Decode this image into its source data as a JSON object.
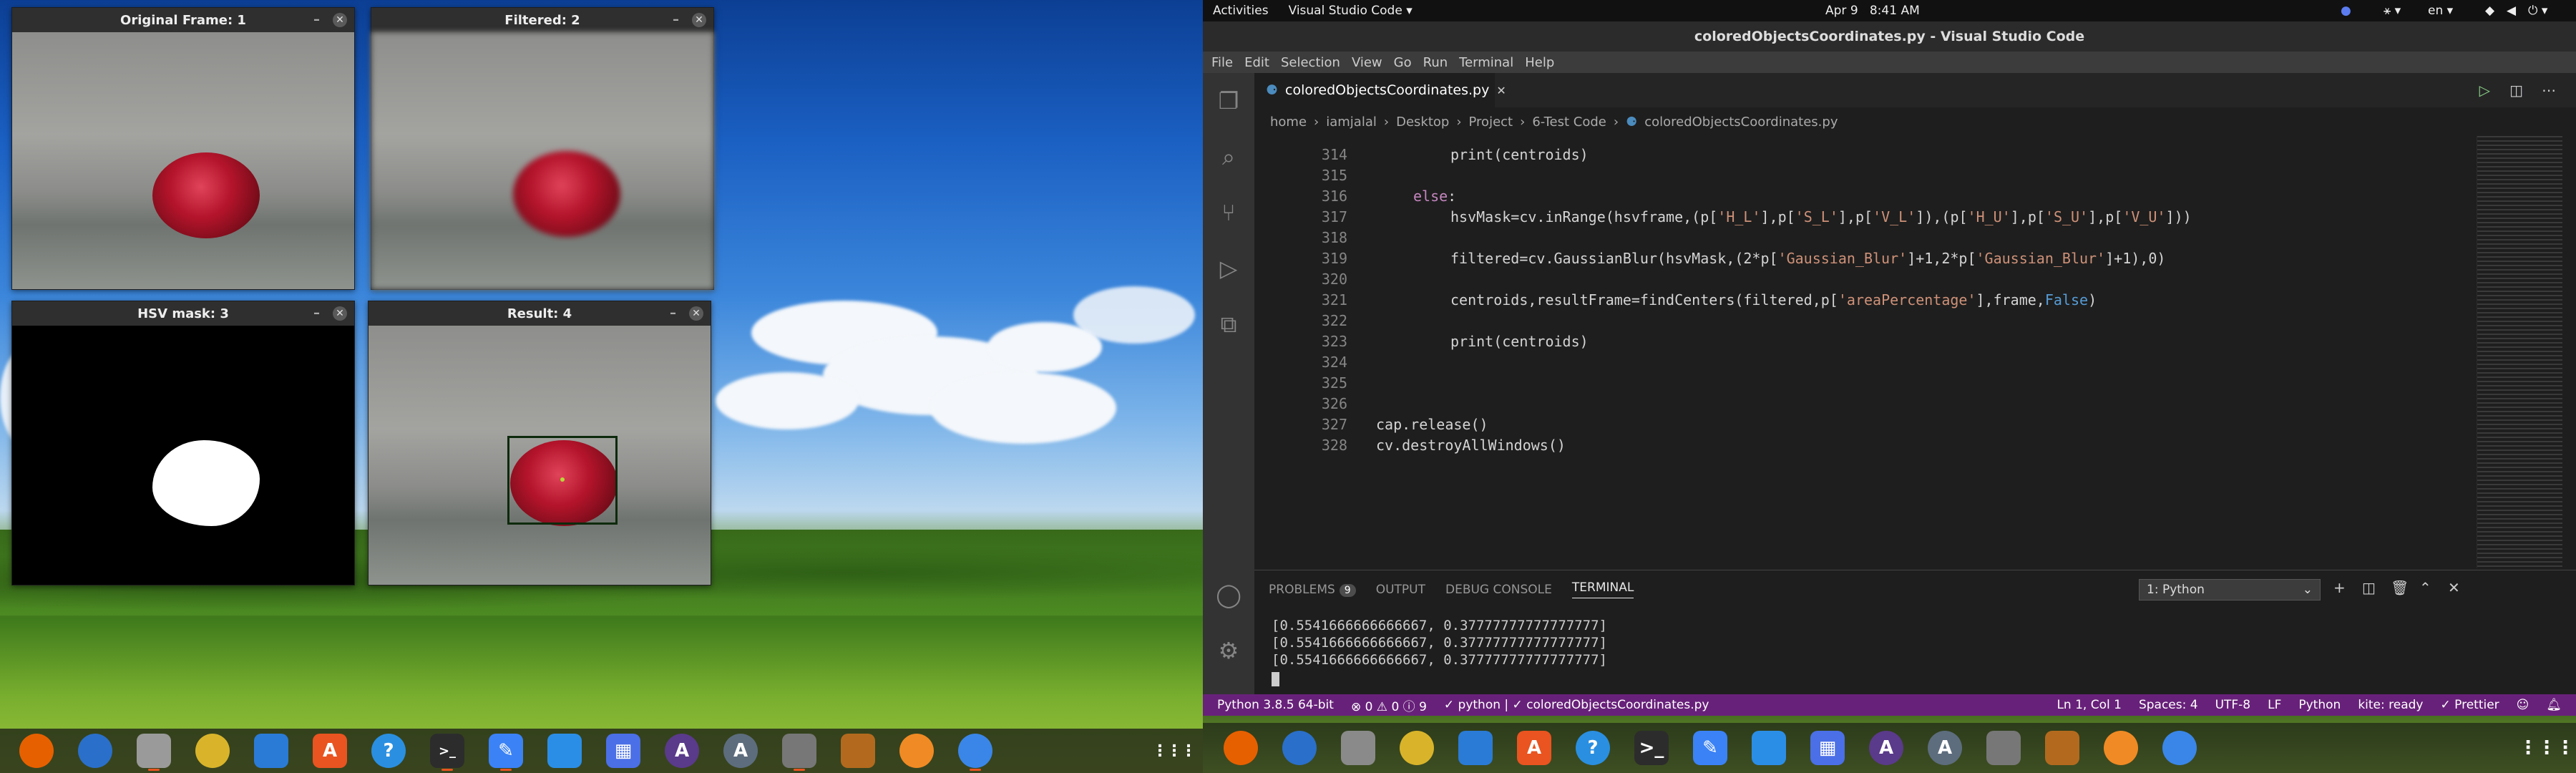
{
  "left_monitor": {
    "windows": [
      {
        "title": "Original Frame: 1"
      },
      {
        "title": "Filtered: 2"
      },
      {
        "title": "HSV mask: 3"
      },
      {
        "title": "Result: 4"
      }
    ],
    "window_controls": {
      "minimize": "–",
      "close": "✕"
    }
  },
  "topbar": {
    "activities": "Activities",
    "app_menu": "Visual Studio Code ▾",
    "date": "Apr 9",
    "time": "8:41 AM",
    "language": "en ▾"
  },
  "vscode": {
    "window_title": "coloredObjectsCoordinates.py - Visual Studio Code",
    "menu": [
      "File",
      "Edit",
      "Selection",
      "View",
      "Go",
      "Run",
      "Terminal",
      "Help"
    ],
    "tab": {
      "label": "coloredObjectsCoordinates.py",
      "close": "✕"
    },
    "breadcrumb": [
      "home",
      "iamjalal",
      "Desktop",
      "Project",
      "6-Test Code",
      "coloredObjectsCoordinates.py"
    ],
    "code_lines": [
      {
        "num": "314",
        "indent": 4,
        "html": "print(centroids)"
      },
      {
        "num": "315",
        "indent": 0,
        "html": ""
      },
      {
        "num": "316",
        "indent": 2,
        "html": "else:"
      },
      {
        "num": "317",
        "indent": 4,
        "html": "hsvMask=cv.inRange(hsvframe,(p['H_L'],p['S_L'],p['V_L']),(p['H_U'],p['S_U'],p['V_U']))"
      },
      {
        "num": "318",
        "indent": 0,
        "html": ""
      },
      {
        "num": "319",
        "indent": 4,
        "html": "filtered=cv.GaussianBlur(hsvMask,(2*p['Gaussian_Blur']+1,2*p['Gaussian_Blur']+1),0)"
      },
      {
        "num": "320",
        "indent": 0,
        "html": ""
      },
      {
        "num": "321",
        "indent": 4,
        "html": "centroids,resultFrame=findCenters(filtered,p['areaPercentage'],frame,False)"
      },
      {
        "num": "322",
        "indent": 0,
        "html": ""
      },
      {
        "num": "323",
        "indent": 4,
        "html": "print(centroids)"
      },
      {
        "num": "324",
        "indent": 0,
        "html": ""
      },
      {
        "num": "325",
        "indent": 0,
        "html": ""
      },
      {
        "num": "326",
        "indent": 0,
        "html": ""
      },
      {
        "num": "327",
        "indent": 0,
        "html": "cap.release()"
      },
      {
        "num": "328",
        "indent": 0,
        "html": "cv.destroyAllWindows()"
      }
    ],
    "panel": {
      "tabs": [
        "PROBLEMS",
        "OUTPUT",
        "DEBUG CONSOLE",
        "TERMINAL"
      ],
      "problems_count": "9",
      "terminal_select": "1: Python",
      "terminal_lines": [
        "[0.5541666666666667, 0.37777777777777777]",
        "[0.5541666666666667, 0.37777777777777777]",
        "[0.5541666666666667, 0.37777777777777777]"
      ]
    },
    "statusbar": {
      "interpreter": "Python 3.8.5 64-bit",
      "problems": "⊗ 0 ⚠ 0 ⓘ 9",
      "python": "✓ python | ✓ coloredObjectsCoordinates.py",
      "position": "Ln 1, Col 1",
      "spaces": "Spaces: 4",
      "encoding": "UTF-8",
      "eol": "LF",
      "language": "Python",
      "kite": "kite: ready",
      "prettier": "✓ Prettier"
    }
  },
  "dock_apps": [
    {
      "name": "firefox-icon",
      "glyph": "",
      "color": "#e66000"
    },
    {
      "name": "thunderbird-icon",
      "glyph": "",
      "color": "#2a6fc9"
    },
    {
      "name": "files-icon",
      "glyph": "",
      "color": "#8a8a8a"
    },
    {
      "name": "rhythmbox-icon",
      "glyph": "",
      "color": "#d9b42a"
    },
    {
      "name": "writer-icon",
      "glyph": "",
      "color": "#2a7bd6"
    },
    {
      "name": "software-icon",
      "glyph": "A",
      "color": "#e95420"
    },
    {
      "name": "help-icon",
      "glyph": "?",
      "color": "#2a8fe0"
    },
    {
      "name": "terminal-icon",
      "glyph": ">_",
      "color": "#2c2c2c"
    },
    {
      "name": "text-editor-icon",
      "glyph": "✎",
      "color": "#3b82f6"
    },
    {
      "name": "vscode-icon",
      "glyph": "",
      "color": "#2b8ee6"
    },
    {
      "name": "screenshot-icon",
      "glyph": "▦",
      "color": "#4b6fe6"
    },
    {
      "name": "inkscape-icon",
      "glyph": "A",
      "color": "#5a3a8a"
    },
    {
      "name": "atom-icon",
      "glyph": "A",
      "color": "#5d6d7e"
    },
    {
      "name": "gimp-icon",
      "glyph": "",
      "color": "#777"
    },
    {
      "name": "book-icon",
      "glyph": "",
      "color": "#b36a1e"
    },
    {
      "name": "blender-icon",
      "glyph": "",
      "color": "#f08a24"
    },
    {
      "name": "chromium-icon",
      "glyph": "",
      "color": "#3a86e8"
    },
    {
      "name": "app-grid-icon",
      "glyph": "⋮⋮⋮",
      "color": "transparent"
    }
  ]
}
